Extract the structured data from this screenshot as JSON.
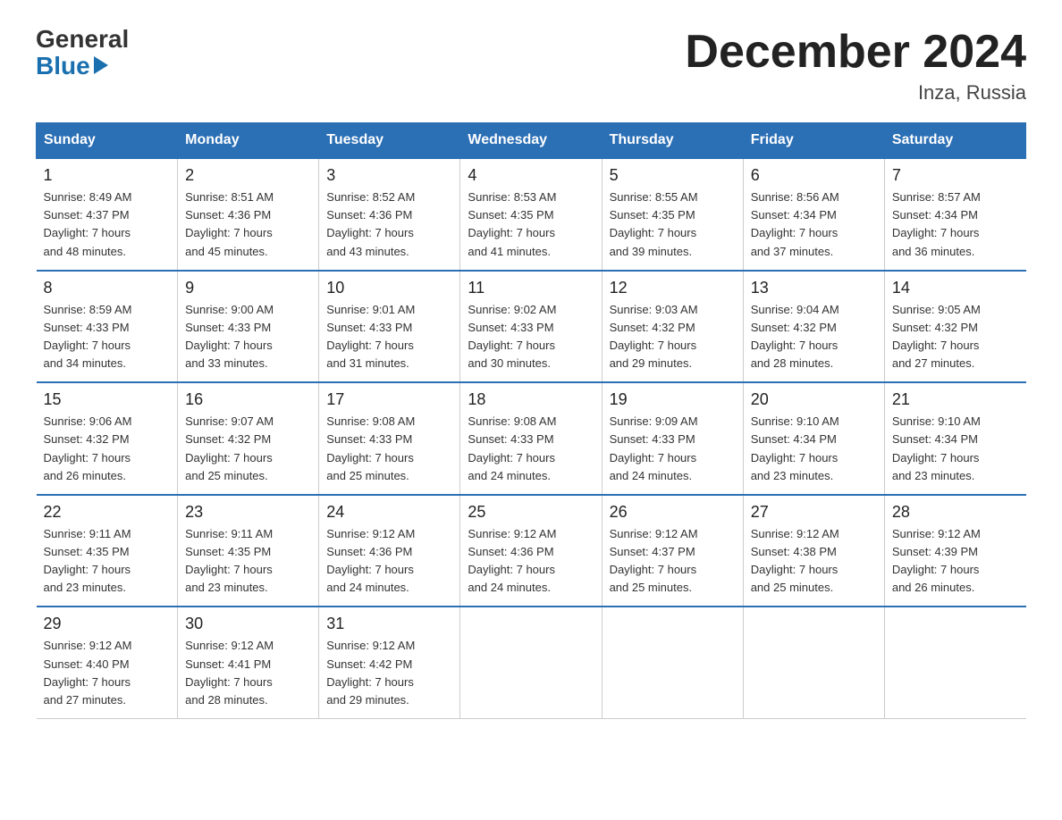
{
  "logo": {
    "general": "General",
    "blue": "Blue"
  },
  "title": "December 2024",
  "location": "Inza, Russia",
  "days_of_week": [
    "Sunday",
    "Monday",
    "Tuesday",
    "Wednesday",
    "Thursday",
    "Friday",
    "Saturday"
  ],
  "weeks": [
    [
      {
        "day": "1",
        "sunrise": "8:49 AM",
        "sunset": "4:37 PM",
        "daylight": "7 hours and 48 minutes."
      },
      {
        "day": "2",
        "sunrise": "8:51 AM",
        "sunset": "4:36 PM",
        "daylight": "7 hours and 45 minutes."
      },
      {
        "day": "3",
        "sunrise": "8:52 AM",
        "sunset": "4:36 PM",
        "daylight": "7 hours and 43 minutes."
      },
      {
        "day": "4",
        "sunrise": "8:53 AM",
        "sunset": "4:35 PM",
        "daylight": "7 hours and 41 minutes."
      },
      {
        "day": "5",
        "sunrise": "8:55 AM",
        "sunset": "4:35 PM",
        "daylight": "7 hours and 39 minutes."
      },
      {
        "day": "6",
        "sunrise": "8:56 AM",
        "sunset": "4:34 PM",
        "daylight": "7 hours and 37 minutes."
      },
      {
        "day": "7",
        "sunrise": "8:57 AM",
        "sunset": "4:34 PM",
        "daylight": "7 hours and 36 minutes."
      }
    ],
    [
      {
        "day": "8",
        "sunrise": "8:59 AM",
        "sunset": "4:33 PM",
        "daylight": "7 hours and 34 minutes."
      },
      {
        "day": "9",
        "sunrise": "9:00 AM",
        "sunset": "4:33 PM",
        "daylight": "7 hours and 33 minutes."
      },
      {
        "day": "10",
        "sunrise": "9:01 AM",
        "sunset": "4:33 PM",
        "daylight": "7 hours and 31 minutes."
      },
      {
        "day": "11",
        "sunrise": "9:02 AM",
        "sunset": "4:33 PM",
        "daylight": "7 hours and 30 minutes."
      },
      {
        "day": "12",
        "sunrise": "9:03 AM",
        "sunset": "4:32 PM",
        "daylight": "7 hours and 29 minutes."
      },
      {
        "day": "13",
        "sunrise": "9:04 AM",
        "sunset": "4:32 PM",
        "daylight": "7 hours and 28 minutes."
      },
      {
        "day": "14",
        "sunrise": "9:05 AM",
        "sunset": "4:32 PM",
        "daylight": "7 hours and 27 minutes."
      }
    ],
    [
      {
        "day": "15",
        "sunrise": "9:06 AM",
        "sunset": "4:32 PM",
        "daylight": "7 hours and 26 minutes."
      },
      {
        "day": "16",
        "sunrise": "9:07 AM",
        "sunset": "4:32 PM",
        "daylight": "7 hours and 25 minutes."
      },
      {
        "day": "17",
        "sunrise": "9:08 AM",
        "sunset": "4:33 PM",
        "daylight": "7 hours and 25 minutes."
      },
      {
        "day": "18",
        "sunrise": "9:08 AM",
        "sunset": "4:33 PM",
        "daylight": "7 hours and 24 minutes."
      },
      {
        "day": "19",
        "sunrise": "9:09 AM",
        "sunset": "4:33 PM",
        "daylight": "7 hours and 24 minutes."
      },
      {
        "day": "20",
        "sunrise": "9:10 AM",
        "sunset": "4:34 PM",
        "daylight": "7 hours and 23 minutes."
      },
      {
        "day": "21",
        "sunrise": "9:10 AM",
        "sunset": "4:34 PM",
        "daylight": "7 hours and 23 minutes."
      }
    ],
    [
      {
        "day": "22",
        "sunrise": "9:11 AM",
        "sunset": "4:35 PM",
        "daylight": "7 hours and 23 minutes."
      },
      {
        "day": "23",
        "sunrise": "9:11 AM",
        "sunset": "4:35 PM",
        "daylight": "7 hours and 23 minutes."
      },
      {
        "day": "24",
        "sunrise": "9:12 AM",
        "sunset": "4:36 PM",
        "daylight": "7 hours and 24 minutes."
      },
      {
        "day": "25",
        "sunrise": "9:12 AM",
        "sunset": "4:36 PM",
        "daylight": "7 hours and 24 minutes."
      },
      {
        "day": "26",
        "sunrise": "9:12 AM",
        "sunset": "4:37 PM",
        "daylight": "7 hours and 25 minutes."
      },
      {
        "day": "27",
        "sunrise": "9:12 AM",
        "sunset": "4:38 PM",
        "daylight": "7 hours and 25 minutes."
      },
      {
        "day": "28",
        "sunrise": "9:12 AM",
        "sunset": "4:39 PM",
        "daylight": "7 hours and 26 minutes."
      }
    ],
    [
      {
        "day": "29",
        "sunrise": "9:12 AM",
        "sunset": "4:40 PM",
        "daylight": "7 hours and 27 minutes."
      },
      {
        "day": "30",
        "sunrise": "9:12 AM",
        "sunset": "4:41 PM",
        "daylight": "7 hours and 28 minutes."
      },
      {
        "day": "31",
        "sunrise": "9:12 AM",
        "sunset": "4:42 PM",
        "daylight": "7 hours and 29 minutes."
      },
      null,
      null,
      null,
      null
    ]
  ]
}
